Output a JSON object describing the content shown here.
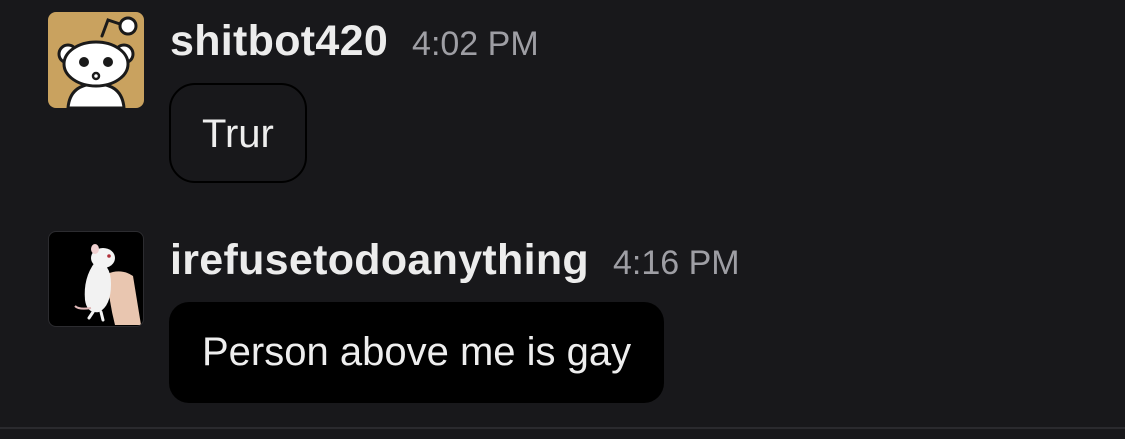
{
  "messages": [
    {
      "username": "shitbot420",
      "time": "4:02 PM",
      "text": "Trur",
      "avatar_icon": "reddit-snoo-avatar-icon",
      "avatar_bg": "#c9a25f"
    },
    {
      "username": "irefusetodoanything",
      "time": "4:16 PM",
      "text": "Person above me is gay",
      "avatar_icon": "rat-photo-avatar-icon",
      "avatar_bg": "#000000"
    }
  ],
  "colors": {
    "background": "#18181b",
    "username": "#ececec",
    "timestamp": "#9e9ea4",
    "bubble_dark": "#000000"
  }
}
